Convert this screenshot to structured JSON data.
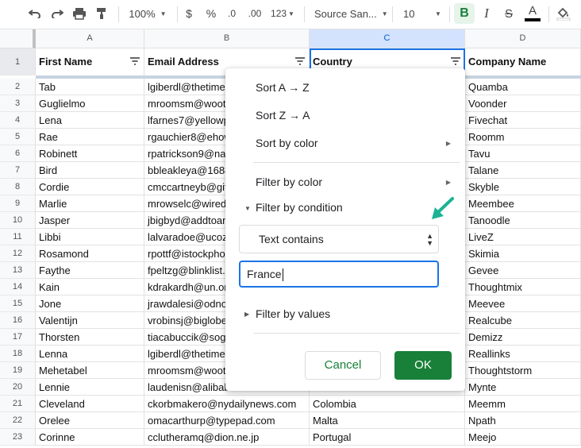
{
  "toolbar": {
    "zoom": "100%",
    "currency": "$",
    "percent": "%",
    "decrease_decimals": ".0",
    "increase_decimals": ".00",
    "more_formats": "123",
    "font": "Source San...",
    "font_size": "10",
    "bold": "B",
    "italic": "I",
    "strike": "S",
    "text_color": "A",
    "icons": [
      "undo-icon",
      "redo-icon",
      "print-icon",
      "paint-format-icon",
      "caret-down-icon",
      "fill-color-icon"
    ]
  },
  "columns": [
    "A",
    "B",
    "C",
    "D"
  ],
  "headers": [
    "First Name",
    "Email Address",
    "Country",
    "Company Name"
  ],
  "rows": [
    {
      "n": "1"
    },
    {
      "n": "2",
      "a": "Tab",
      "b": "lgiberdl@thetime",
      "c": "",
      "d": "Quamba"
    },
    {
      "n": "3",
      "a": "Guglielmo",
      "b": "mroomsm@woot",
      "c": "",
      "d": "Voonder"
    },
    {
      "n": "4",
      "a": "Lena",
      "b": "lfarnes7@yellowp",
      "c": "",
      "d": "Fivechat"
    },
    {
      "n": "5",
      "a": "Rae",
      "b": "rgauchier8@ehow",
      "c": "",
      "d": "Roomm"
    },
    {
      "n": "6",
      "a": "Robinett",
      "b": "rpatrickson9@nar",
      "c": "",
      "d": "Tavu"
    },
    {
      "n": "7",
      "a": "Bird",
      "b": "bbleakleya@1688",
      "c": "",
      "d": "Talane"
    },
    {
      "n": "8",
      "a": "Cordie",
      "b": "cmccartneyb@git",
      "c": "",
      "d": "Skyble"
    },
    {
      "n": "9",
      "a": "Marlie",
      "b": "mrowselc@wired.",
      "c": "",
      "d": "Meembee"
    },
    {
      "n": "10",
      "a": "Jasper",
      "b": "jbigbyd@addtoan",
      "c": "",
      "d": "Tanoodle"
    },
    {
      "n": "11",
      "a": "Libbi",
      "b": "lalvaradoe@ucoz.",
      "c": "",
      "d": "LiveZ"
    },
    {
      "n": "12",
      "a": "Rosamond",
      "b": "rpottf@istockpho",
      "c": "",
      "d": "Skimia"
    },
    {
      "n": "13",
      "a": "Faythe",
      "b": "fpeltzg@blinklist.",
      "c": "",
      "d": "Gevee"
    },
    {
      "n": "14",
      "a": "Kain",
      "b": "kdrakardh@un.or",
      "c": "",
      "d": "Thoughtmix"
    },
    {
      "n": "15",
      "a": "Jone",
      "b": "jrawdalesi@odno",
      "c": "",
      "d": "Meevee"
    },
    {
      "n": "16",
      "a": "Valentijn",
      "b": "vrobinsj@biglobe",
      "c": "",
      "d": "Realcube"
    },
    {
      "n": "17",
      "a": "Thorsten",
      "b": "tiacabuccik@sogo",
      "c": "",
      "d": "Demizz"
    },
    {
      "n": "18",
      "a": "Lenna",
      "b": "lgiberdl@thetime",
      "c": "",
      "d": "Reallinks"
    },
    {
      "n": "19",
      "a": "Mehetabel",
      "b": "mroomsm@woot",
      "c": "",
      "d": "Thoughtstorm"
    },
    {
      "n": "20",
      "a": "Lennie",
      "b": "laudenisn@alibab",
      "c": "",
      "d": "Mynte"
    },
    {
      "n": "21",
      "a": "Cleveland",
      "b": "ckorbmakero@nydailynews.com",
      "c": "Colombia",
      "d": "Meemm"
    },
    {
      "n": "22",
      "a": "Orelee",
      "b": "omacarthurp@typepad.com",
      "c": "Malta",
      "d": "Npath"
    },
    {
      "n": "23",
      "a": "Corinne",
      "b": "cclutheramq@dion.ne.jp",
      "c": "Portugal",
      "d": "Meejo"
    }
  ],
  "menu": {
    "sort_az": "Sort A → Z",
    "sort_za": "Sort Z → A",
    "sort_by_color": "Sort by color",
    "filter_by_color": "Filter by color",
    "filter_by_condition": "Filter by condition",
    "condition_value": "Text contains",
    "condition_input": "France",
    "filter_by_values": "Filter by values",
    "cancel": "Cancel",
    "ok": "OK"
  },
  "colors": {
    "accent": "#188038",
    "arrow": "#1ab394",
    "selection": "#1a73e8"
  }
}
